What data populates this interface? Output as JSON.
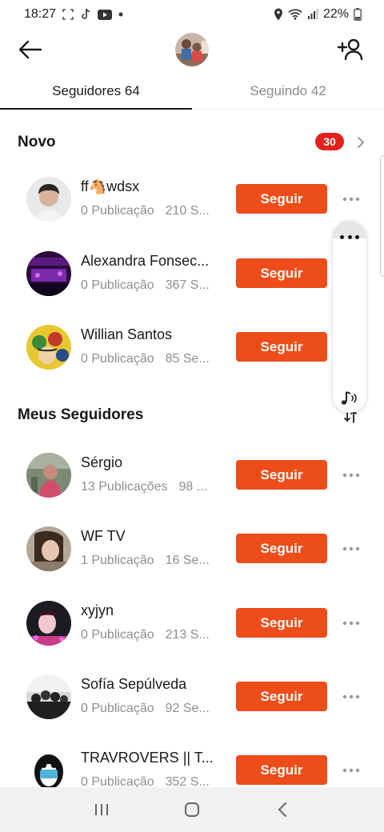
{
  "status_bar": {
    "time": "18:27",
    "battery": "22%"
  },
  "header": {
    "back_icon": "arrow-left-icon",
    "add_user_icon": "add-user-icon"
  },
  "tabs": [
    {
      "label": "Seguidores 64",
      "active": true
    },
    {
      "label": "Seguindo 42",
      "active": false
    }
  ],
  "sections": {
    "new": {
      "title": "Novo",
      "badge": "30"
    },
    "followers": {
      "title": "Meus Seguidores"
    }
  },
  "follow_label": "Seguir",
  "new_users": [
    {
      "name": "ff🐴wdsx",
      "posts": "0 Publicação",
      "followers": "210 S..."
    },
    {
      "name": "Alexandra Fonsec...",
      "posts": "0 Publicação",
      "followers": "367 S..."
    },
    {
      "name": "Willian Santos",
      "posts": "0 Publicação",
      "followers": "85 Se..."
    }
  ],
  "followers_list": [
    {
      "name": "Sérgio",
      "posts": "13 Publicações",
      "followers": "98 ..."
    },
    {
      "name": "WF TV",
      "posts": "1 Publicação",
      "followers": "16 Se..."
    },
    {
      "name": "xyjyn",
      "posts": "0 Publicação",
      "followers": "213 S..."
    },
    {
      "name": "Sofía Sepúlveda",
      "posts": "0 Publicação",
      "followers": "92 Se..."
    },
    {
      "name": "TRAVROVERS || T...",
      "posts": "0 Publicação",
      "followers": "352 S..."
    }
  ],
  "colors": {
    "accent": "#ee4d1a",
    "badge": "#e3201b"
  }
}
